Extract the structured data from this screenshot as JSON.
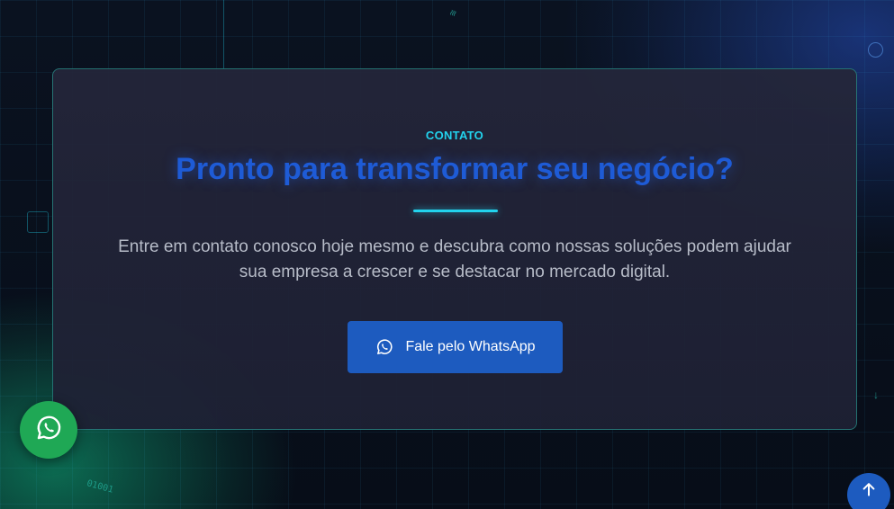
{
  "contact": {
    "eyebrow": "CONTATO",
    "title": "Pronto para transformar seu negócio?",
    "description": "Entre em contato conosco hoje mesmo e descubra como nossas soluções podem ajudar sua empresa a crescer e se destacar no mercado digital.",
    "cta_label": "Fale pelo WhatsApp",
    "cta_icon": "whatsapp-icon"
  },
  "floating": {
    "whatsapp_icon": "whatsapp-icon",
    "back_to_top_icon": "arrow-up-icon"
  },
  "decor": {
    "binary_text": "01001"
  },
  "colors": {
    "accent_cyan": "#22d3ee",
    "title_blue": "#1e5bd6",
    "button_blue": "#1d5bbf",
    "whatsapp_green": "#1fa855",
    "card_bg": "#24263a"
  }
}
